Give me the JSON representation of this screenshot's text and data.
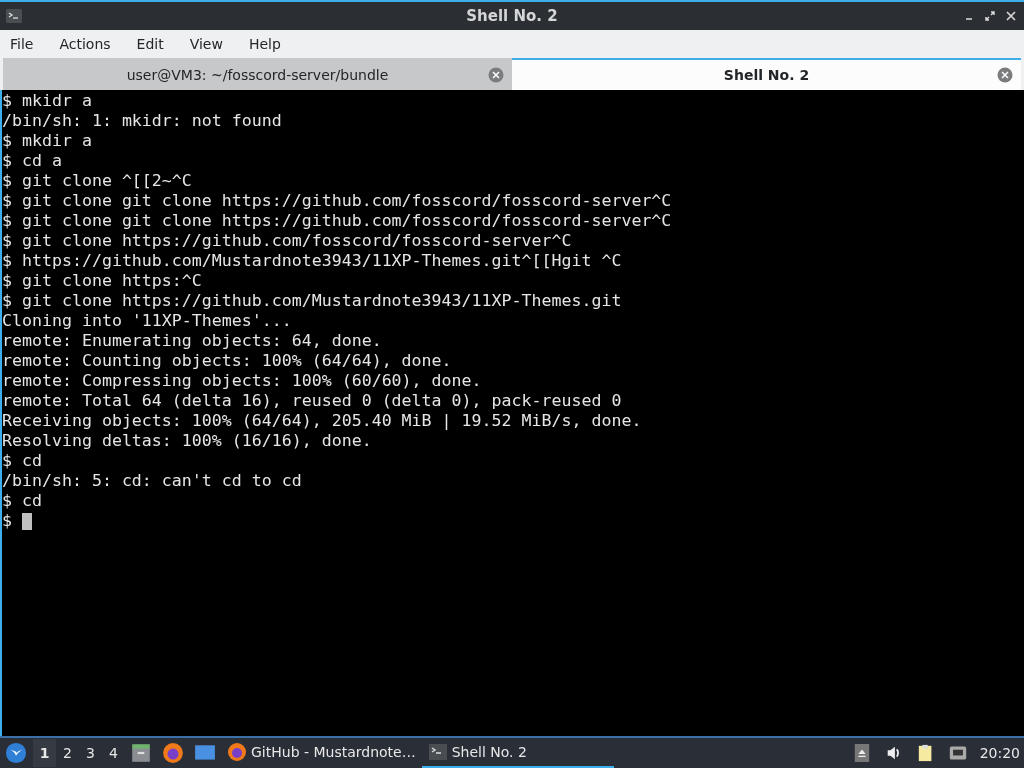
{
  "window": {
    "title": "Shell No. 2"
  },
  "menu": [
    "File",
    "Actions",
    "Edit",
    "View",
    "Help"
  ],
  "tabs": [
    {
      "label": "user@VM3: ~/fosscord-server/bundle",
      "selected": false
    },
    {
      "label": "Shell No. 2",
      "selected": true
    }
  ],
  "terminal": {
    "lines": [
      "$ mkidr a",
      "/bin/sh: 1: mkidr: not found",
      "$ mkdir a",
      "$ cd a",
      "$ git clone ^[[2~^C",
      "$ git clone git clone https://github.com/fosscord/fosscord-server^C",
      "$ git clone git clone https://github.com/fosscord/fosscord-server^C",
      "$ git clone https://github.com/fosscord/fosscord-server^C",
      "$ https://github.com/Mustardnote3943/11XP-Themes.git^[[Hgit ^C",
      "$ git clone https:^C",
      "$ git clone https://github.com/Mustardnote3943/11XP-Themes.git",
      "Cloning into '11XP-Themes'...",
      "remote: Enumerating objects: 64, done.",
      "remote: Counting objects: 100% (64/64), done.",
      "remote: Compressing objects: 100% (60/60), done.",
      "remote: Total 64 (delta 16), reused 0 (delta 0), pack-reused 0",
      "Receiving objects: 100% (64/64), 205.40 MiB | 19.52 MiB/s, done.",
      "Resolving deltas: 100% (16/16), done.",
      "$ cd",
      "/bin/sh: 5: cd: can't cd to cd",
      "$ cd"
    ],
    "prompt": "$"
  },
  "taskbar": {
    "workspaces": [
      {
        "label": "1",
        "selected": true
      },
      {
        "label": "2",
        "selected": false
      },
      {
        "label": "3",
        "selected": false
      },
      {
        "label": "4",
        "selected": false
      }
    ],
    "tasks": [
      {
        "kind": "browser",
        "label": "GitHub - Mustardnote…",
        "selected": false
      },
      {
        "kind": "terminal",
        "label": "Shell No. 2",
        "selected": true
      }
    ],
    "clock": "20:20"
  }
}
